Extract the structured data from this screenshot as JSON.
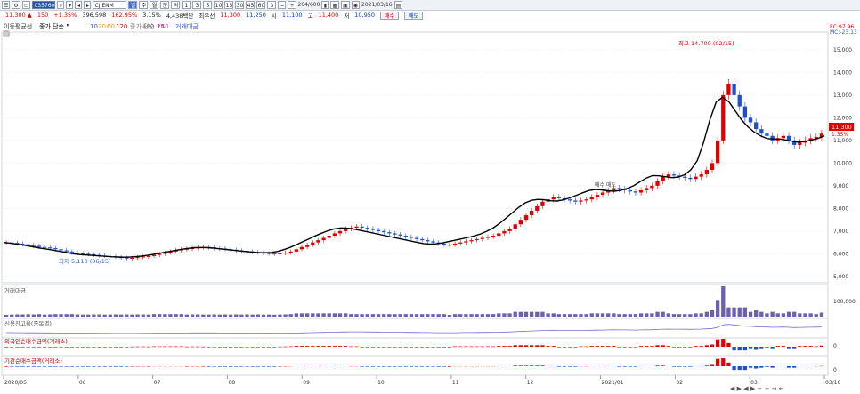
{
  "toolbar": {
    "code": "035760",
    "name": "CJ ENM",
    "unit_label": "일",
    "period_buttons": [
      "1",
      "3",
      "5",
      "10",
      "15",
      "30",
      "45",
      "60",
      "3"
    ],
    "count": "204/600",
    "date": "2021/03/16"
  },
  "quote": {
    "price": "11,300 ▲",
    "change": "150",
    "change_pct": "+1.35%",
    "volume": "396,598",
    "volume_pct": "162.95%",
    "turnover": "3.15%",
    "amount": "4,438백만",
    "prev_label": "최우선",
    "prev_value": "11,300",
    "bid": "11,250",
    "open_label": "시",
    "open_value": "11,100",
    "high_label": "고",
    "high_value": "11,400",
    "low_label": "저",
    "low_value": "10,950",
    "buy_button": "매수",
    "sell_button": "매도"
  },
  "chart_data": {
    "type": "line",
    "title": "",
    "legend_top": [
      "이동평균선",
      "종가 단순 5",
      "10",
      "20",
      "60",
      "120",
      "종가 단순 240",
      "480",
      "15",
      "거래대금"
    ],
    "legend_colors": {
      "ma5": "#000000",
      "ma10": "#2b55d6",
      "ma20": "#f0a000",
      "ma60": "#f08a00",
      "ma120": "#e00000",
      "ma240": "#7f7f7f",
      "ma480": "#d400d4"
    },
    "x_tick_labels": [
      "2020/05",
      "06",
      "07",
      "08",
      "09",
      "10",
      "11",
      "12",
      "2021/01",
      "02",
      "03",
      "03/16"
    ],
    "y_ticks": [
      5000,
      6000,
      7000,
      8000,
      9000,
      10000,
      11000,
      12000,
      13000,
      14000,
      15000
    ],
    "y_tick_labels": [
      "5,000",
      "6,000",
      "7,000",
      "8,000",
      "9,000",
      "10,000",
      "11,000",
      "12,000",
      "13,000",
      "14,000",
      "15,000"
    ],
    "ylim": [
      4800,
      15700
    ],
    "top_right_labels": [
      "EC:97.96",
      "MC:-23.13"
    ],
    "high_annotation": "최고 14,700 (02/15)",
    "low_annotation": "최저 5,110 (06/15)",
    "mid_annotation": "매수 매도",
    "current_price_label": "11,300",
    "current_pct_label": "1.35%",
    "candles_close": [
      6500,
      6480,
      6450,
      6420,
      6380,
      6350,
      6300,
      6280,
      6250,
      6200,
      6150,
      6100,
      6050,
      6020,
      6000,
      5980,
      5950,
      5920,
      5900,
      5880,
      5850,
      5830,
      5800,
      5820,
      5850,
      5880,
      5900,
      5950,
      6000,
      6050,
      6100,
      6150,
      6200,
      6220,
      6250,
      6280,
      6300,
      6280,
      6250,
      6230,
      6200,
      6180,
      6150,
      6130,
      6100,
      6080,
      6050,
      6030,
      6010,
      6000,
      6020,
      6050,
      6100,
      6200,
      6300,
      6400,
      6500,
      6600,
      6700,
      6800,
      6900,
      7000,
      7100,
      7150,
      7200,
      7150,
      7100,
      7050,
      7000,
      6950,
      6900,
      6850,
      6800,
      6750,
      6700,
      6650,
      6600,
      6550,
      6500,
      6450,
      6400,
      6400,
      6450,
      6500,
      6550,
      6600,
      6650,
      6700,
      6750,
      6800,
      6900,
      7000,
      7100,
      7300,
      7500,
      7700,
      7900,
      8100,
      8300,
      8400,
      8500,
      8450,
      8400,
      8350,
      8300,
      8350,
      8400,
      8500,
      8600,
      8700,
      8800,
      8900,
      8850,
      8800,
      8750,
      8700,
      8800,
      8900,
      9000,
      9200,
      9400,
      9500,
      9450,
      9400,
      9350,
      9300,
      9400,
      9500,
      9700,
      10000,
      11000,
      13000,
      13500,
      13000,
      12500,
      12000,
      11800,
      11500,
      11300,
      11200,
      11000,
      11100,
      11200,
      11000,
      10800,
      10900,
      11000,
      11100,
      11150,
      11300
    ],
    "ma5_values": [
      6500,
      6470,
      6430,
      6390,
      6340,
      6290,
      6240,
      6200,
      6150,
      6100,
      6050,
      6000,
      5970,
      5950,
      5930,
      5910,
      5890,
      5870,
      5860,
      5850,
      5860,
      5880,
      5910,
      5950,
      6000,
      6050,
      6100,
      6150,
      6200,
      6240,
      6270,
      6280,
      6270,
      6250,
      6220,
      6190,
      6160,
      6130,
      6100,
      6080,
      6060,
      6050,
      6060,
      6100,
      6180,
      6280,
      6400,
      6530,
      6660,
      6790,
      6910,
      7020,
      7100,
      7140,
      7130,
      7090,
      7040,
      6980,
      6920,
      6860,
      6800,
      6740,
      6680,
      6620,
      6560,
      6500,
      6450,
      6430,
      6440,
      6480,
      6540,
      6600,
      6660,
      6720,
      6790,
      6880,
      7000,
      7150,
      7350,
      7580,
      7820,
      8060,
      8250,
      8360,
      8400,
      8380,
      8340,
      8330,
      8380,
      8470,
      8580,
      8690,
      8790,
      8840,
      8820,
      8780,
      8760,
      8800,
      8880,
      9000,
      9170,
      9340,
      9450,
      9440,
      9400,
      9360,
      9380,
      9480,
      9700,
      10100,
      10900,
      11900,
      12700,
      12900,
      12700,
      12300,
      11900,
      11600,
      11360,
      11200,
      11080,
      11060,
      11060,
      11020,
      10960,
      10920,
      10960,
      11020,
      11090,
      11200
    ]
  },
  "panels": {
    "volume": {
      "label": "거래대금",
      "y_label": "100,000"
    },
    "margin": {
      "label": "신용잔고율(종목별)"
    },
    "foreign": {
      "label": "외국인순매수금액(거래소)",
      "y_label": "0"
    },
    "institution": {
      "label": "기관순매수금액(거래소)",
      "y_label": "0"
    }
  }
}
